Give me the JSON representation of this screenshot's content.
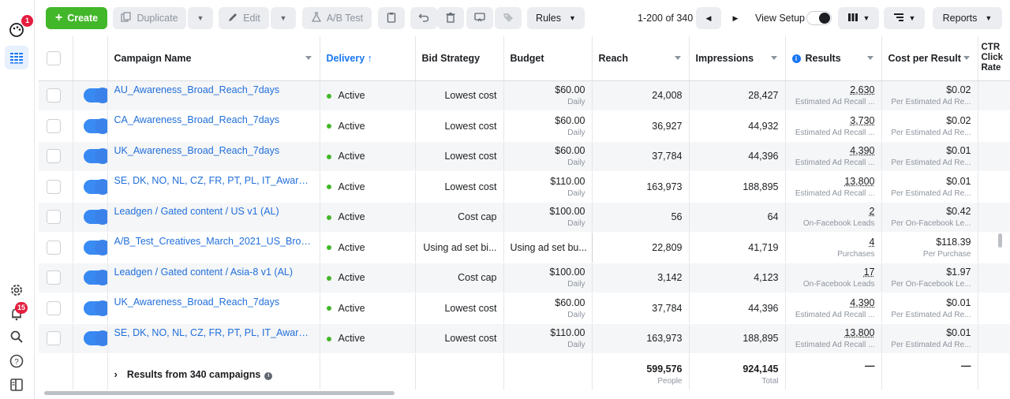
{
  "rail": {
    "notif_badge": "1",
    "alerts_badge": "15"
  },
  "toolbar": {
    "create": "Create",
    "duplicate": "Duplicate",
    "edit": "Edit",
    "ab_test": "A/B Test",
    "rules": "Rules",
    "pager": "1-200 of 340",
    "view_setup": "View Setup",
    "reports": "Reports"
  },
  "table": {
    "headers": {
      "campaign_name": "Campaign Name",
      "delivery": "Delivery ↑",
      "bid_strategy": "Bid Strategy",
      "budget": "Budget",
      "reach": "Reach",
      "impressions": "Impressions",
      "results": "Results",
      "cost_per_result": "Cost per Result",
      "ctr_line1": "CTR",
      "ctr_line2": "Click",
      "ctr_line3": "Rate"
    },
    "rows": [
      {
        "name": "AU_Awareness_Broad_Reach_7days",
        "delivery": "Active",
        "bid": "Lowest cost",
        "budget": "$60.00",
        "budget_sub": "Daily",
        "reach": "24,008",
        "impressions": "28,427",
        "results": "2,630",
        "results_sub": "Estimated Ad Recall ...",
        "cpr": "$0.02",
        "cpr_sub": "Per Estimated Ad Re..."
      },
      {
        "name": "CA_Awareness_Broad_Reach_7days",
        "delivery": "Active",
        "bid": "Lowest cost",
        "budget": "$60.00",
        "budget_sub": "Daily",
        "reach": "36,927",
        "impressions": "44,932",
        "results": "3,730",
        "results_sub": "Estimated Ad Recall ...",
        "cpr": "$0.02",
        "cpr_sub": "Per Estimated Ad Re..."
      },
      {
        "name": "UK_Awareness_Broad_Reach_7days",
        "delivery": "Active",
        "bid": "Lowest cost",
        "budget": "$60.00",
        "budget_sub": "Daily",
        "reach": "37,784",
        "impressions": "44,396",
        "results": "4,390",
        "results_sub": "Estimated Ad Recall ...",
        "cpr": "$0.01",
        "cpr_sub": "Per Estimated Ad Re..."
      },
      {
        "name": "SE, DK, NO, NL, CZ, FR, PT, PL, IT_Awareness_...",
        "delivery": "Active",
        "bid": "Lowest cost",
        "budget": "$110.00",
        "budget_sub": "Daily",
        "reach": "163,973",
        "impressions": "188,895",
        "results": "13,800",
        "results_sub": "Estimated Ad Recall ...",
        "cpr": "$0.01",
        "cpr_sub": "Per Estimated Ad Re..."
      },
      {
        "name": "Leadgen / Gated content / US v1 (AL)",
        "delivery": "Active",
        "bid": "Cost cap",
        "budget": "$100.00",
        "budget_sub": "Daily",
        "reach": "56",
        "impressions": "64",
        "results": "2",
        "results_sub": "On-Facebook Leads",
        "cpr": "$0.42",
        "cpr_sub": "Per On-Facebook Le..."
      },
      {
        "name": "A/B_Test_Creatives_March_2021_US_Broad_...",
        "delivery": "Active",
        "bid": "Using ad set bi...",
        "budget": "Using ad set bu...",
        "budget_sub": "",
        "reach": "22,809",
        "impressions": "41,719",
        "results": "4",
        "results_sub": "Purchases",
        "cpr": "$118.39",
        "cpr_sub": "Per Purchase"
      },
      {
        "name": "Leadgen / Gated content / Asia-8 v1 (AL)",
        "delivery": "Active",
        "bid": "Cost cap",
        "budget": "$100.00",
        "budget_sub": "Daily",
        "reach": "3,142",
        "impressions": "4,123",
        "results": "17",
        "results_sub": "On-Facebook Leads",
        "cpr": "$1.97",
        "cpr_sub": "Per On-Facebook Le..."
      },
      {
        "name": "UK_Awareness_Broad_Reach_7days",
        "delivery": "Active",
        "bid": "Lowest cost",
        "budget": "$60.00",
        "budget_sub": "Daily",
        "reach": "37,784",
        "impressions": "44,396",
        "results": "4,390",
        "results_sub": "Estimated Ad Recall ...",
        "cpr": "$0.01",
        "cpr_sub": "Per Estimated Ad Re..."
      },
      {
        "name": "SE, DK, NO, NL, CZ, FR, PT, PL, IT_Awareness_...",
        "delivery": "Active",
        "bid": "Lowest cost",
        "budget": "$110.00",
        "budget_sub": "Daily",
        "reach": "163,973",
        "impressions": "188,895",
        "results": "13,800",
        "results_sub": "Estimated Ad Recall ...",
        "cpr": "$0.01",
        "cpr_sub": "Per Estimated Ad Re..."
      }
    ],
    "summary": {
      "label": "Results from 340 campaigns",
      "reach": "599,576",
      "reach_sub": "People",
      "impressions": "924,145",
      "impressions_sub": "Total",
      "results": "—",
      "cpr": "—"
    }
  },
  "colors": {
    "accent": "#1877f2",
    "create": "#42b72a",
    "active_dot": "#42b72a",
    "badge": "#e41e3f"
  }
}
